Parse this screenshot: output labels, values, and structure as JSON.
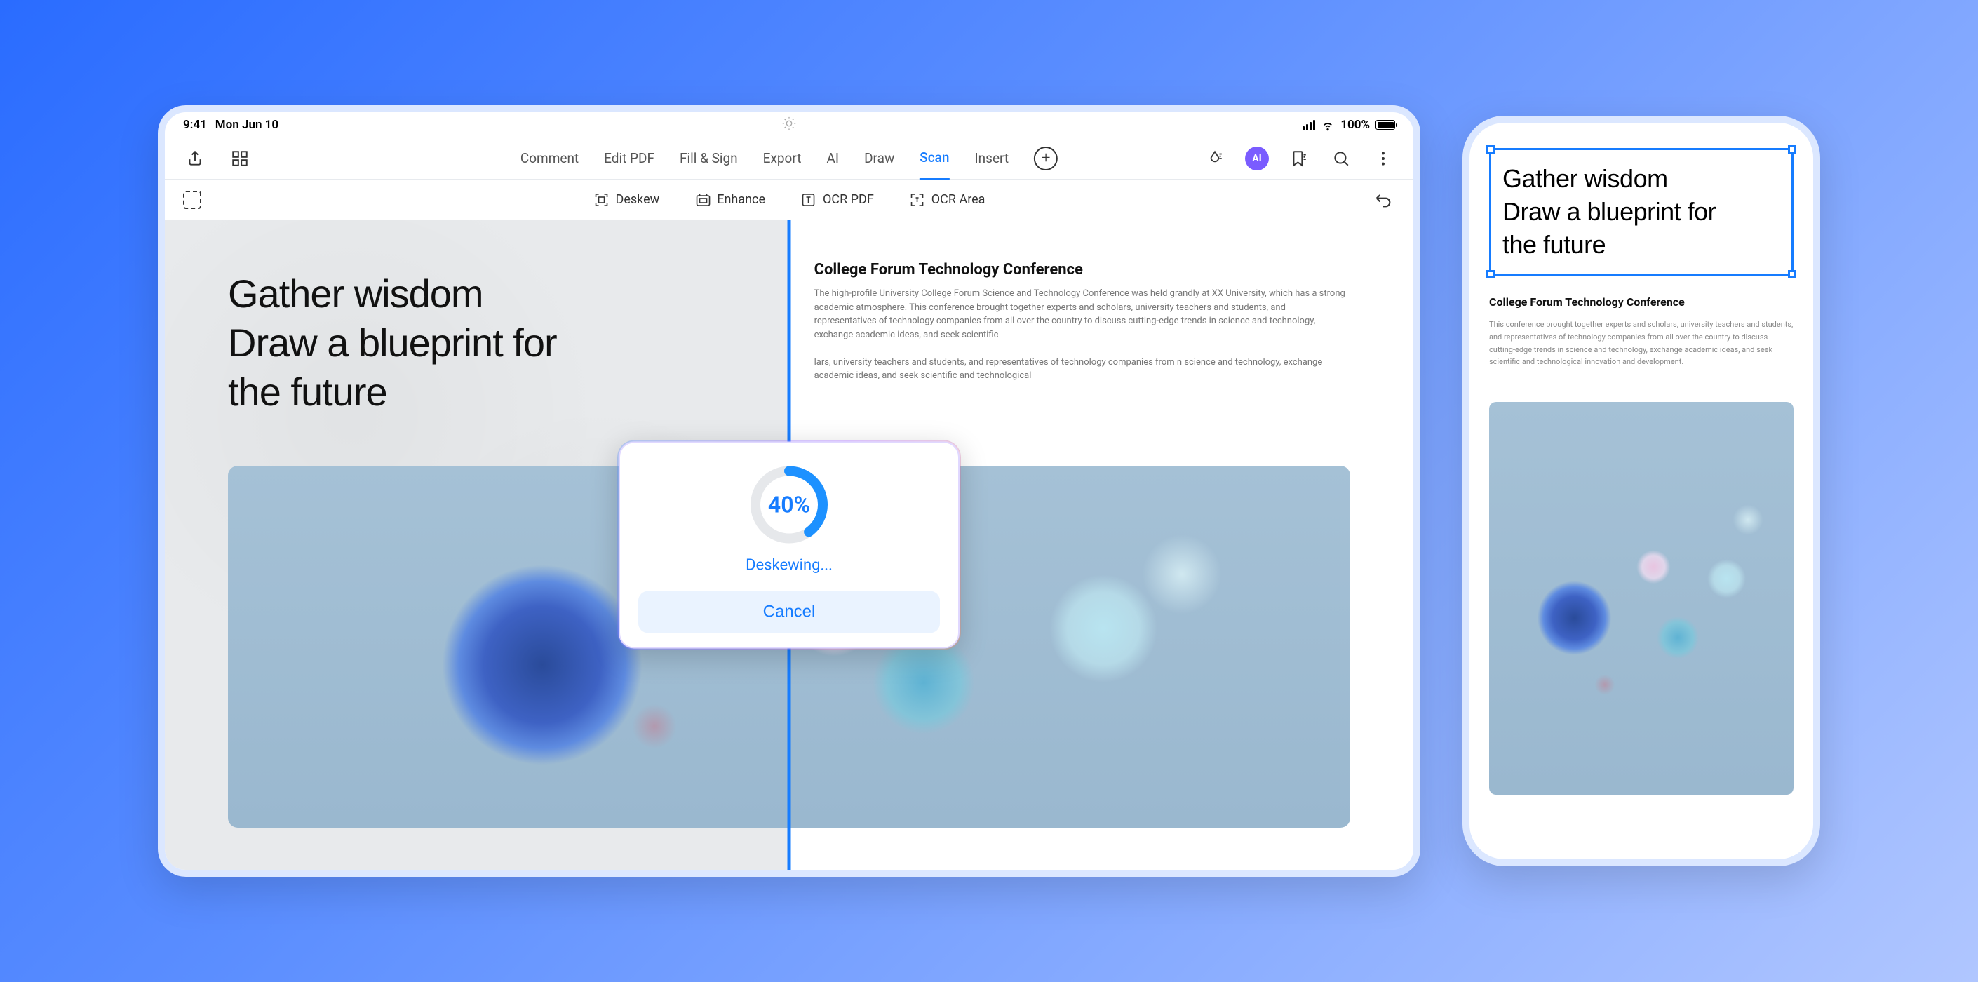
{
  "status": {
    "time": "9:41",
    "date": "Mon Jun 10",
    "battery_pct": "100%"
  },
  "toolbar": {
    "tabs": [
      "Comment",
      "Edit PDF",
      "Fill & Sign",
      "Export",
      "AI",
      "Draw",
      "Scan",
      "Insert"
    ],
    "active": "Scan"
  },
  "scan_tools": {
    "deskew": "Deskew",
    "enhance": "Enhance",
    "ocr_pdf": "OCR PDF",
    "ocr_area": "OCR Area"
  },
  "document": {
    "headline_l1": "Gather wisdom",
    "headline_l2": "Draw a blueprint for",
    "headline_l3": "the future",
    "subheading": "College Forum Technology Conference",
    "body_p1": "The high-profile University College Forum Science and Technology Conference was held grandly at XX University, which has a strong academic atmosphere. This conference brought together experts and scholars, university teachers and students, and representatives of technology companies from all over the country to discuss cutting-edge trends in science and technology, exchange academic ideas, and seek scientific",
    "body_p2": "lars, university teachers and students, and representatives of technology companies from n science and technology, exchange academic ideas, and seek scientific and technological"
  },
  "dialog": {
    "percent_value": 40,
    "percent_label": "40%",
    "status": "Deskewing...",
    "cancel": "Cancel"
  },
  "phone": {
    "headline_l1": "Gather wisdom",
    "headline_l2": "Draw a blueprint for",
    "headline_l3": "the future",
    "subheading": "College Forum Technology Conference",
    "body": "This conference brought together experts and scholars, university teachers and students, and representatives of technology companies from all over the country to discuss cutting-edge trends in science and technology, exchange academic ideas, and seek scientific and technological innovation and development."
  },
  "ai_label": "AI"
}
